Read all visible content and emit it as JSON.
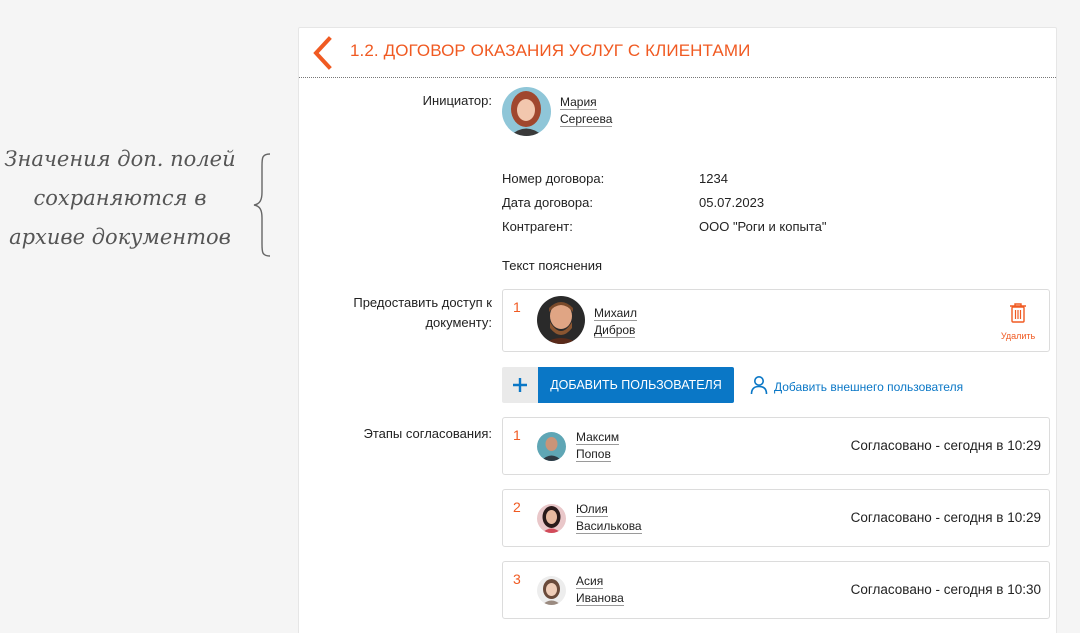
{
  "annotation": {
    "lines": [
      "Значения доп. полей",
      "сохраняются в",
      "архиве документов"
    ]
  },
  "header": {
    "title": "1.2. ДОГОВОР ОКАЗАНИЯ УСЛУГ С КЛИЕНТАМИ"
  },
  "initiator": {
    "label": "Инициатор:",
    "first_name": "Мария",
    "last_name": "Сергеева"
  },
  "fields": [
    {
      "label": "Номер договора:",
      "value": "1234"
    },
    {
      "label": "Дата договора:",
      "value": "05.07.2023"
    },
    {
      "label": "Контрагент:",
      "value": "ООО \"Роги и копыта\""
    }
  ],
  "explanation": "Текст пояснения",
  "access": {
    "label_line1": "Предоставить доступ к",
    "label_line2": "документу:",
    "users": [
      {
        "num": "1",
        "first_name": "Михаил",
        "last_name": "Дибров",
        "delete_label": "Удалить"
      }
    ],
    "add_button_label": "ДОБАВИТЬ ПОЛЬЗОВАТЕЛЯ",
    "add_external_label": "Добавить внешнего пользователя"
  },
  "approval": {
    "label": "Этапы согласования:",
    "stages": [
      {
        "num": "1",
        "first_name": "Максим",
        "last_name": "Попов",
        "status": "Согласовано - сегодня в 10:29"
      },
      {
        "num": "2",
        "first_name": "Юлия",
        "last_name": "Василькова",
        "status": "Согласовано - сегодня в 10:29"
      },
      {
        "num": "3",
        "first_name": "Асия",
        "last_name": "Иванова",
        "status": "Согласовано - сегодня в 10:30"
      }
    ]
  },
  "colors": {
    "accent_orange": "#f05a22",
    "primary_blue": "#0a77c6"
  },
  "icons": [
    "back-arrow-icon",
    "trash-icon",
    "plus-icon",
    "user-outline-icon"
  ]
}
